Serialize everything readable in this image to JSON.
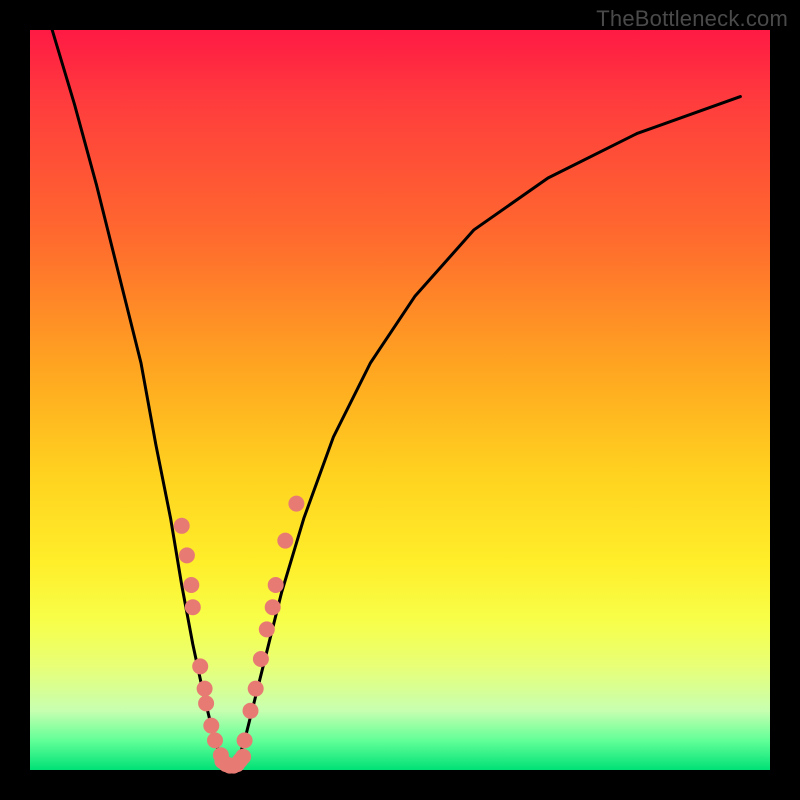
{
  "watermark": "TheBottleneck.com",
  "colors": {
    "frame": "#000000",
    "curve": "#000000",
    "dots": "#e77b74",
    "dot_stroke": "#e77b74"
  },
  "chart_data": {
    "type": "line",
    "title": "",
    "xlabel": "",
    "ylabel": "",
    "xlim": [
      0,
      100
    ],
    "ylim": [
      0,
      100
    ],
    "series": [
      {
        "name": "bottleneck-curve",
        "x": [
          3,
          6,
          9,
          12,
          15,
          17,
          19,
          20.5,
          22,
          23.5,
          25,
          26,
          27,
          28,
          29,
          30,
          32,
          34,
          37,
          41,
          46,
          52,
          60,
          70,
          82,
          96
        ],
        "y": [
          100,
          90,
          79,
          67,
          55,
          44,
          34,
          25,
          17,
          10,
          4,
          1,
          0,
          1,
          4,
          8,
          16,
          24,
          34,
          45,
          55,
          64,
          73,
          80,
          86,
          91
        ]
      }
    ],
    "scatter_points": {
      "name": "sample-dots",
      "points": [
        {
          "x": 20.5,
          "y": 33
        },
        {
          "x": 21.2,
          "y": 29
        },
        {
          "x": 21.8,
          "y": 25
        },
        {
          "x": 22.0,
          "y": 22
        },
        {
          "x": 23.0,
          "y": 14
        },
        {
          "x": 23.6,
          "y": 11
        },
        {
          "x": 23.8,
          "y": 9
        },
        {
          "x": 24.5,
          "y": 6
        },
        {
          "x": 25.0,
          "y": 4
        },
        {
          "x": 25.8,
          "y": 2
        },
        {
          "x": 26.0,
          "y": 1.2
        },
        {
          "x": 26.5,
          "y": 0.8
        },
        {
          "x": 27.0,
          "y": 0.6
        },
        {
          "x": 27.5,
          "y": 0.6
        },
        {
          "x": 28.0,
          "y": 0.8
        },
        {
          "x": 28.4,
          "y": 1.3
        },
        {
          "x": 28.8,
          "y": 1.8
        },
        {
          "x": 29.0,
          "y": 4
        },
        {
          "x": 29.8,
          "y": 8
        },
        {
          "x": 30.5,
          "y": 11
        },
        {
          "x": 31.2,
          "y": 15
        },
        {
          "x": 32.0,
          "y": 19
        },
        {
          "x": 32.8,
          "y": 22
        },
        {
          "x": 33.2,
          "y": 25
        },
        {
          "x": 34.5,
          "y": 31
        },
        {
          "x": 36.0,
          "y": 36
        }
      ]
    }
  }
}
